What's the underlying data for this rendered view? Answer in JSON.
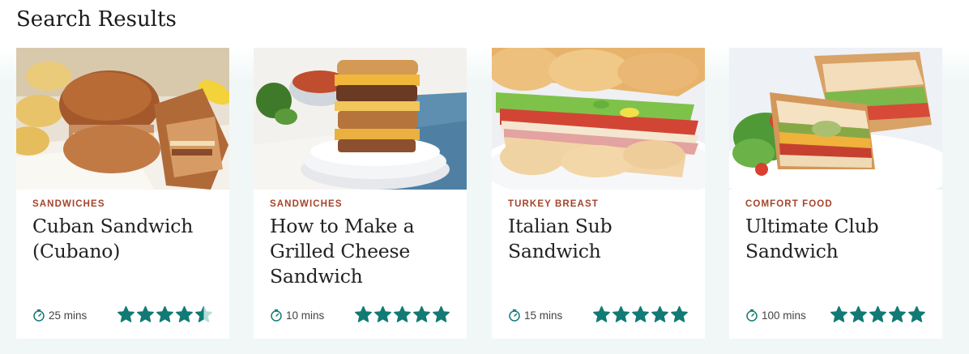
{
  "page": {
    "title": "Search Results"
  },
  "colors": {
    "tag": "#a5442a",
    "star": "#117a74",
    "star_empty": "#b6dcd9",
    "background": "#f1f7f7"
  },
  "icons": {
    "time": "timer-icon",
    "rating": "star-icon"
  },
  "cards": [
    {
      "tag": "SANDWICHES",
      "title": "Cuban Sandwich (Cubano)",
      "time": "25 mins",
      "rating": 4.5,
      "image": "cuban-sandwich-photo"
    },
    {
      "tag": "SANDWICHES",
      "title": "How to Make a Grilled Cheese Sandwich",
      "time": "10 mins",
      "rating": 5,
      "image": "grilled-cheese-photo"
    },
    {
      "tag": "TURKEY BREAST",
      "title": "Italian Sub Sandwich",
      "time": "15 mins",
      "rating": 5,
      "image": "italian-sub-photo"
    },
    {
      "tag": "COMFORT FOOD",
      "title": "Ultimate Club Sandwich",
      "time": "100 mins",
      "rating": 5,
      "image": "club-sandwich-photo"
    }
  ]
}
